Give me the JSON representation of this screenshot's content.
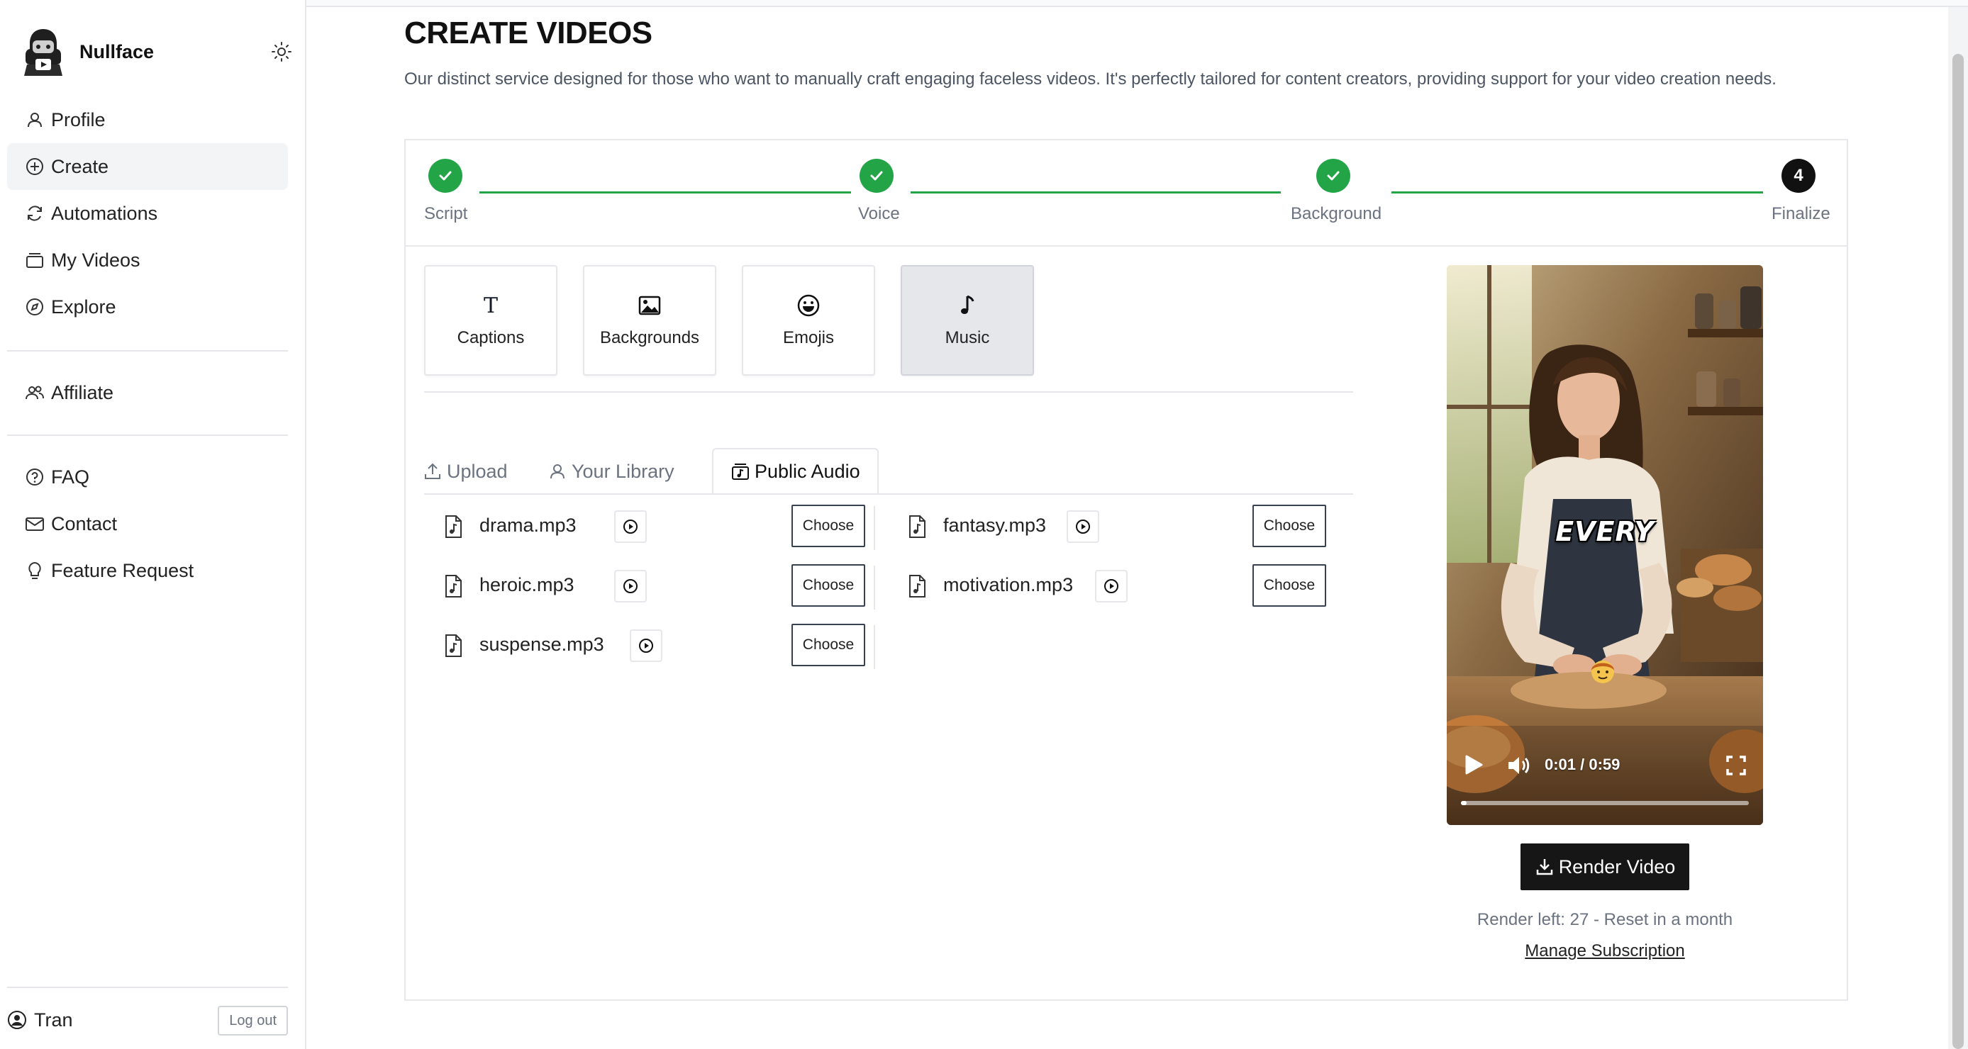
{
  "brand": {
    "name": "Nullface",
    "logo_icon": "robot-avatar-icon",
    "theme_icon": "sun-icon"
  },
  "nav": {
    "group1": [
      {
        "label": "Profile",
        "icon": "user-icon"
      },
      {
        "label": "Create",
        "icon": "plus-circle-icon",
        "active": true
      },
      {
        "label": "Automations",
        "icon": "refresh-icon"
      },
      {
        "label": "My Videos",
        "icon": "videos-stack-icon"
      },
      {
        "label": "Explore",
        "icon": "compass-icon"
      }
    ],
    "group2": [
      {
        "label": "Affiliate",
        "icon": "users-icon"
      }
    ],
    "group3": [
      {
        "label": "FAQ",
        "icon": "help-circle-icon"
      },
      {
        "label": "Contact",
        "icon": "mail-icon"
      },
      {
        "label": "Feature Request",
        "icon": "lightbulb-icon"
      }
    ]
  },
  "user": {
    "name": "Tran",
    "logout_label": "Log out"
  },
  "page": {
    "title": "CREATE VIDEOS",
    "description": "Our distinct service designed for those who want to manually craft engaging faceless videos. It's perfectly tailored for content creators, providing support for your video creation needs."
  },
  "stepper": {
    "steps": [
      {
        "label": "Script",
        "status": "done"
      },
      {
        "label": "Voice",
        "status": "done"
      },
      {
        "label": "Background",
        "status": "done"
      },
      {
        "label": "Finalize",
        "status": "current",
        "number": "4"
      }
    ]
  },
  "tools": [
    {
      "label": "Captions",
      "icon": "text-icon"
    },
    {
      "label": "Backgrounds",
      "icon": "image-icon"
    },
    {
      "label": "Emojis",
      "icon": "smile-icon"
    },
    {
      "label": "Music",
      "icon": "music-note-icon",
      "active": true
    }
  ],
  "tabs": [
    {
      "label": "Upload",
      "icon": "upload-icon"
    },
    {
      "label": "Your Library",
      "icon": "user-icon"
    },
    {
      "label": "Public Audio",
      "icon": "audio-library-icon",
      "active": true
    }
  ],
  "audio": {
    "choose_label": "Choose",
    "items": [
      {
        "name": "drama.mp3"
      },
      {
        "name": "fantasy.mp3"
      },
      {
        "name": "heroic.mp3"
      },
      {
        "name": "motivation.mp3"
      },
      {
        "name": "suspense.mp3"
      }
    ]
  },
  "preview": {
    "caption_word": "EVERY",
    "time": "0:01 / 0:59",
    "progress": 0.02
  },
  "render": {
    "button_label": "Render Video",
    "renders_left": "Render left: 27 - Reset in a month",
    "manage_label": "Manage Subscription"
  },
  "colors": {
    "success": "#22a447",
    "dark": "#161616",
    "muted": "#6b7280",
    "border": "#e5e7eb"
  }
}
